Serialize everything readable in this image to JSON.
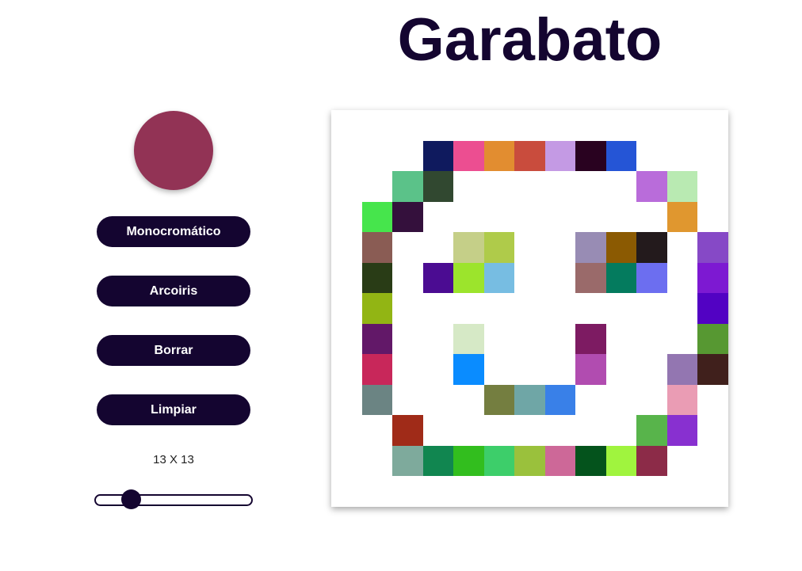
{
  "app": {
    "title": "Garabato"
  },
  "current_color": "#923355",
  "buttons": {
    "monochrome": "Monocromático",
    "rainbow": "Arcoiris",
    "erase": "Borrar",
    "clear": "Limpiar"
  },
  "grid": {
    "size_label": "13 X 13",
    "size": 13,
    "cells": [
      [
        "#ffffff",
        "#ffffff",
        "#ffffff",
        "#ffffff",
        "#ffffff",
        "#ffffff",
        "#ffffff",
        "#ffffff",
        "#ffffff",
        "#ffffff",
        "#ffffff",
        "#ffffff",
        "#ffffff"
      ],
      [
        "#ffffff",
        "#ffffff",
        "#ffffff",
        "#0f1a5e",
        "#ec4e91",
        "#e28d30",
        "#c94c3d",
        "#c49ae4",
        "#290220",
        "#2555d6",
        "#ffffff",
        "#ffffff",
        "#ffffff"
      ],
      [
        "#ffffff",
        "#ffffff",
        "#5bc289",
        "#314830",
        "#ffffff",
        "#ffffff",
        "#ffffff",
        "#ffffff",
        "#ffffff",
        "#ffffff",
        "#b96cda",
        "#b9eab2",
        "#ffffff"
      ],
      [
        "#ffffff",
        "#46e54c",
        "#34103c",
        "#ffffff",
        "#ffffff",
        "#ffffff",
        "#ffffff",
        "#ffffff",
        "#ffffff",
        "#ffffff",
        "#ffffff",
        "#e0972f",
        "#ffffff"
      ],
      [
        "#ffffff",
        "#8a5c54",
        "#ffffff",
        "#ffffff",
        "#c5cf88",
        "#afcb4a",
        "#ffffff",
        "#ffffff",
        "#988cb4",
        "#8b5a02",
        "#231a1c",
        "#ffffff",
        "#8649c6"
      ],
      [
        "#ffffff",
        "#293c16",
        "#ffffff",
        "#4b0c92",
        "#9ce42c",
        "#77bde2",
        "#ffffff",
        "#ffffff",
        "#9a6a6a",
        "#047b5e",
        "#6c6ef0",
        "#ffffff",
        "#7d19d2"
      ],
      [
        "#ffffff",
        "#92b514",
        "#ffffff",
        "#ffffff",
        "#ffffff",
        "#ffffff",
        "#ffffff",
        "#ffffff",
        "#ffffff",
        "#ffffff",
        "#ffffff",
        "#ffffff",
        "#5202c3"
      ],
      [
        "#ffffff",
        "#621868",
        "#ffffff",
        "#ffffff",
        "#d6e9c6",
        "#ffffff",
        "#ffffff",
        "#ffffff",
        "#7d1b62",
        "#ffffff",
        "#ffffff",
        "#ffffff",
        "#579832"
      ],
      [
        "#ffffff",
        "#c8275a",
        "#ffffff",
        "#ffffff",
        "#0a8cff",
        "#ffffff",
        "#ffffff",
        "#ffffff",
        "#b14cb0",
        "#ffffff",
        "#ffffff",
        "#9376b1",
        "#40201c"
      ],
      [
        "#ffffff",
        "#6b8483",
        "#ffffff",
        "#ffffff",
        "#ffffff",
        "#747e40",
        "#6fa6a6",
        "#3980e8",
        "#ffffff",
        "#ffffff",
        "#ffffff",
        "#ea9cb4",
        "#ffffff"
      ],
      [
        "#ffffff",
        "#ffffff",
        "#a02b18",
        "#ffffff",
        "#ffffff",
        "#ffffff",
        "#ffffff",
        "#ffffff",
        "#ffffff",
        "#ffffff",
        "#58b44b",
        "#8830d0",
        "#ffffff"
      ],
      [
        "#ffffff",
        "#ffffff",
        "#7eaa9c",
        "#118650",
        "#32be1e",
        "#3dce6a",
        "#9ac13c",
        "#cd6898",
        "#04531c",
        "#a0f43e",
        "#8c2b48",
        "#ffffff",
        "#ffffff"
      ],
      [
        "#ffffff",
        "#ffffff",
        "#ffffff",
        "#ffffff",
        "#ffffff",
        "#ffffff",
        "#ffffff",
        "#ffffff",
        "#ffffff",
        "#ffffff",
        "#ffffff",
        "#ffffff",
        "#ffffff"
      ]
    ]
  },
  "slider": {
    "min": 2,
    "max": 64,
    "value": 13
  },
  "colors": {
    "primary": "#140530",
    "button_text": "#ffffff",
    "background": "#ffffff"
  }
}
